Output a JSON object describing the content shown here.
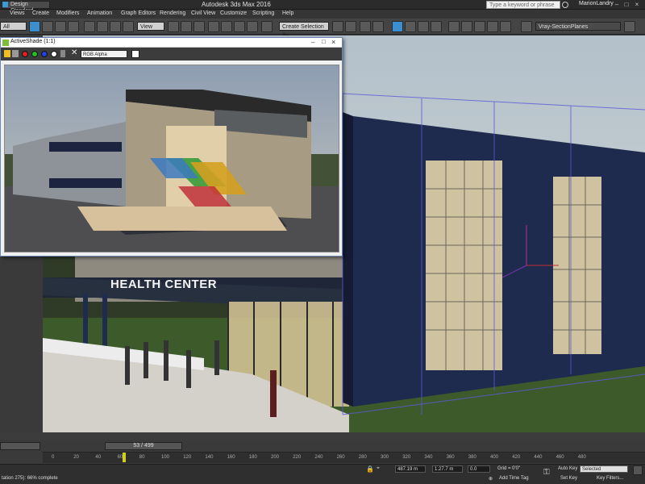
{
  "titlebar": {
    "workspace": "Design Standard",
    "app_title": "Autodesk 3ds Max 2016",
    "search_placeholder": "Type a keyword or phrase",
    "user": "MarionLandry"
  },
  "menu": [
    "Views",
    "Create",
    "Modifiers",
    "Animation",
    "Graph Editors",
    "Rendering",
    "Civil View",
    "Customize",
    "Scripting",
    "Help"
  ],
  "toolbar": {
    "filter": "All",
    "ref_coord": "View",
    "selection_set": "Create Selection Se",
    "layer": "Vray-SectionPlanes"
  },
  "activeshade": {
    "title": "ActiveShade (1:1)",
    "channel": "RGB Alpha"
  },
  "viewport": {
    "sign_text": "HEALTH CENTER"
  },
  "timeline": {
    "frame": "53 / 499",
    "ticks": [
      "0",
      "20",
      "40",
      "60",
      "80",
      "100",
      "120",
      "140",
      "160",
      "180",
      "200",
      "220",
      "240",
      "260",
      "280",
      "300",
      "320",
      "340",
      "360",
      "380",
      "400",
      "420",
      "440",
      "460",
      "480"
    ]
  },
  "status": {
    "message": "tation 275): 66% complete",
    "x": "487.19 m",
    "y": "1.27.7 m",
    "z": "0.0",
    "grid": "Grid = 0'0\"",
    "add_time_tag": "Add Time Tag",
    "auto_key": "Auto Key",
    "selected": "Selected",
    "set_key": "Set Key",
    "key_filters": "Key Filters..."
  },
  "colors": {
    "accent": "#3b8fd1",
    "sky": "#b8c4cc",
    "building_blue": "#1e2a4e",
    "grass": "#3b5a28"
  }
}
